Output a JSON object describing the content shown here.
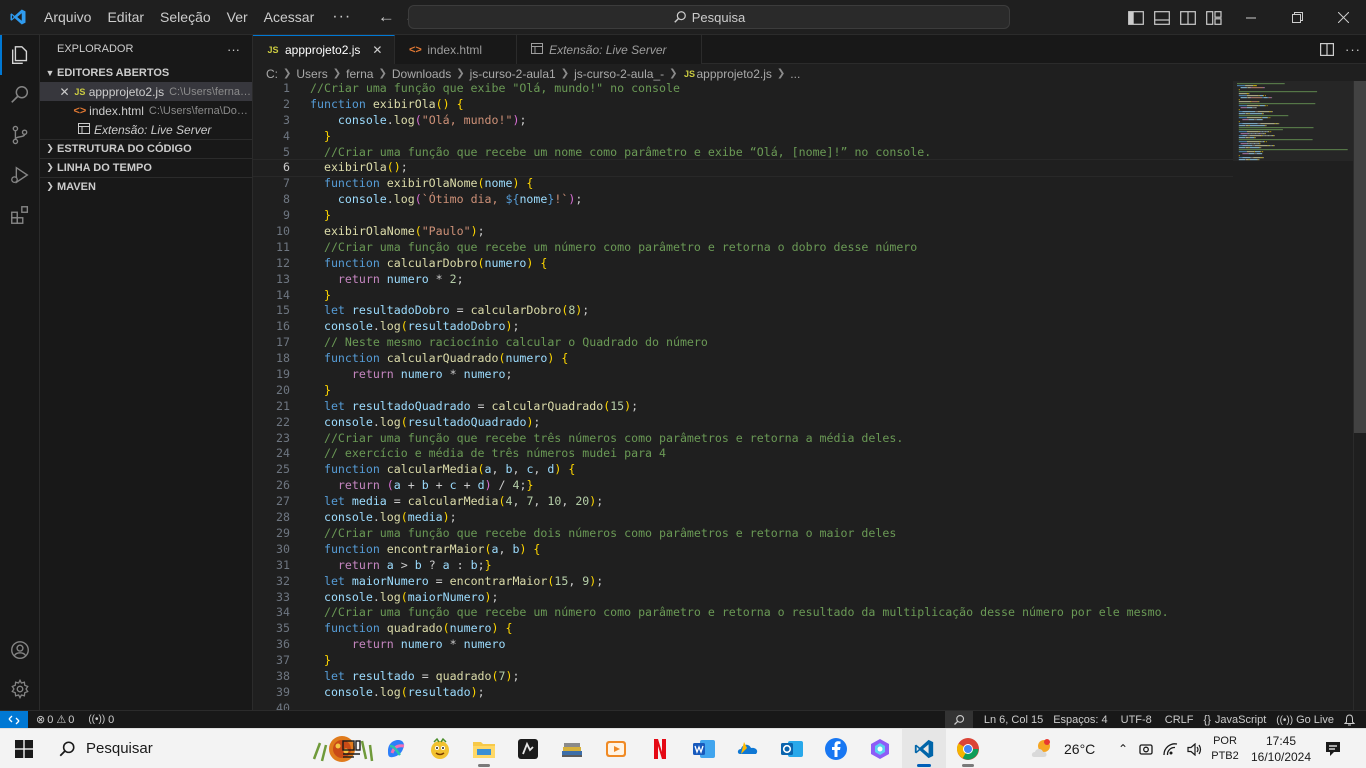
{
  "titlebar": {
    "menu": [
      "Arquivo",
      "Editar",
      "Seleção",
      "Ver",
      "Acessar"
    ],
    "more": "···",
    "search_label": "Pesquisa"
  },
  "sidebar": {
    "title": "EXPLORADOR",
    "more": "···",
    "sections": {
      "open_editors": "EDITORES ABERTOS",
      "outline": "ESTRUTURA DO CÓDIGO",
      "timeline": "LINHA DO TEMPO",
      "maven": "MAVEN"
    },
    "open_files": [
      {
        "name": "appprojeto2.js",
        "path": "C:\\Users\\ferna\\Do...",
        "type": "js"
      },
      {
        "name": "index.html",
        "path": "C:\\Users\\ferna\\Downl...",
        "type": "html"
      },
      {
        "name": "Extensão: Live Server",
        "path": "",
        "type": "ext"
      }
    ]
  },
  "tabs": [
    {
      "label": "appprojeto2.js",
      "type": "js",
      "active": true
    },
    {
      "label": "index.html",
      "type": "html",
      "active": false
    },
    {
      "label": "Extensão: Live Server",
      "type": "ext",
      "active": false
    }
  ],
  "breadcrumb": [
    "C:",
    "Users",
    "ferna",
    "Downloads",
    "js-curso-2-aula1",
    "js-curso-2-aula_-",
    "appprojeto2.js",
    "..."
  ],
  "editor": {
    "current_line": 6,
    "lines": [
      [
        [
          "c-com",
          "//Criar uma função que exibe \"Olá, mundo!\" no console"
        ]
      ],
      [
        [
          "c-kw",
          "function "
        ],
        [
          "c-fn",
          "exibirOla"
        ],
        [
          "c-brk1",
          "() {"
        ]
      ],
      [
        [
          "c-txt",
          "    "
        ],
        [
          "c-var",
          "console"
        ],
        [
          "c-txt",
          "."
        ],
        [
          "c-fn",
          "log"
        ],
        [
          "c-brk2",
          "("
        ],
        [
          "c-str",
          "\"Olá, mundo!\""
        ],
        [
          "c-brk2",
          ")"
        ],
        [
          "c-txt",
          ";"
        ]
      ],
      [
        [
          "c-txt",
          "  "
        ],
        [
          "c-brk1",
          "}"
        ]
      ],
      [
        [
          "c-txt",
          "  "
        ],
        [
          "c-com",
          "//Criar uma função que recebe um nome como parâmetro e exibe “Olá, [nome]!” no console."
        ]
      ],
      [
        [
          "c-txt",
          "  "
        ],
        [
          "c-fn",
          "exibirOla"
        ],
        [
          "c-brk1",
          "()"
        ],
        [
          "c-txt",
          ";"
        ]
      ],
      [
        [
          "c-txt",
          "  "
        ],
        [
          "c-kw",
          "function "
        ],
        [
          "c-fn",
          "exibirOlaNome"
        ],
        [
          "c-brk1",
          "("
        ],
        [
          "c-var",
          "nome"
        ],
        [
          "c-brk1",
          ")"
        ],
        [
          "c-txt",
          " "
        ],
        [
          "c-brk1",
          "{"
        ]
      ],
      [
        [
          "c-txt",
          "    "
        ],
        [
          "c-var",
          "console"
        ],
        [
          "c-txt",
          "."
        ],
        [
          "c-fn",
          "log"
        ],
        [
          "c-brk2",
          "("
        ],
        [
          "c-str",
          "`Ótimo dia, "
        ],
        [
          "c-kw",
          "${"
        ],
        [
          "c-var",
          "nome"
        ],
        [
          "c-kw",
          "}"
        ],
        [
          "c-str",
          "!`"
        ],
        [
          "c-brk2",
          ")"
        ],
        [
          "c-txt",
          ";"
        ]
      ],
      [
        [
          "c-txt",
          "  "
        ],
        [
          "c-brk1",
          "}"
        ]
      ],
      [
        [
          "c-txt",
          "  "
        ],
        [
          "c-fn",
          "exibirOlaNome"
        ],
        [
          "c-brk1",
          "("
        ],
        [
          "c-str",
          "\"Paulo\""
        ],
        [
          "c-brk1",
          ")"
        ],
        [
          "c-txt",
          ";"
        ]
      ],
      [
        [
          "c-txt",
          "  "
        ],
        [
          "c-com",
          "//Criar uma função que recebe um número como parâmetro e retorna o dobro desse número"
        ]
      ],
      [
        [
          "c-txt",
          "  "
        ],
        [
          "c-kw",
          "function "
        ],
        [
          "c-fn",
          "calcularDobro"
        ],
        [
          "c-brk1",
          "("
        ],
        [
          "c-var",
          "numero"
        ],
        [
          "c-brk1",
          ")"
        ],
        [
          "c-txt",
          " "
        ],
        [
          "c-brk1",
          "{"
        ]
      ],
      [
        [
          "c-txt",
          "    "
        ],
        [
          "c-ctl",
          "return "
        ],
        [
          "c-var",
          "numero"
        ],
        [
          "c-txt",
          " * "
        ],
        [
          "c-num",
          "2"
        ],
        [
          "c-txt",
          ";"
        ]
      ],
      [
        [
          "c-txt",
          "  "
        ],
        [
          "c-brk1",
          "}"
        ]
      ],
      [
        [
          "c-txt",
          "  "
        ],
        [
          "c-kw",
          "let "
        ],
        [
          "c-var",
          "resultadoDobro"
        ],
        [
          "c-txt",
          " = "
        ],
        [
          "c-fn",
          "calcularDobro"
        ],
        [
          "c-brk1",
          "("
        ],
        [
          "c-num",
          "8"
        ],
        [
          "c-brk1",
          ")"
        ],
        [
          "c-txt",
          ";"
        ]
      ],
      [
        [
          "c-txt",
          "  "
        ],
        [
          "c-var",
          "console"
        ],
        [
          "c-txt",
          "."
        ],
        [
          "c-fn",
          "log"
        ],
        [
          "c-brk1",
          "("
        ],
        [
          "c-var",
          "resultadoDobro"
        ],
        [
          "c-brk1",
          ")"
        ],
        [
          "c-txt",
          ";"
        ]
      ],
      [
        [
          "c-txt",
          "  "
        ],
        [
          "c-com",
          "// Neste mesmo raciocínio calcular o Quadrado do número"
        ]
      ],
      [
        [
          "c-txt",
          "  "
        ],
        [
          "c-kw",
          "function "
        ],
        [
          "c-fn",
          "calcularQuadrado"
        ],
        [
          "c-brk1",
          "("
        ],
        [
          "c-var",
          "numero"
        ],
        [
          "c-brk1",
          ")"
        ],
        [
          "c-txt",
          " "
        ],
        [
          "c-brk1",
          "{"
        ]
      ],
      [
        [
          "c-txt",
          "      "
        ],
        [
          "c-ctl",
          "return "
        ],
        [
          "c-var",
          "numero"
        ],
        [
          "c-txt",
          " * "
        ],
        [
          "c-var",
          "numero"
        ],
        [
          "c-txt",
          ";"
        ]
      ],
      [
        [
          "c-txt",
          "  "
        ],
        [
          "c-brk1",
          "}"
        ]
      ],
      [
        [
          "c-txt",
          "  "
        ],
        [
          "c-kw",
          "let "
        ],
        [
          "c-var",
          "resultadoQuadrado"
        ],
        [
          "c-txt",
          " = "
        ],
        [
          "c-fn",
          "calcularQuadrado"
        ],
        [
          "c-brk1",
          "("
        ],
        [
          "c-num",
          "15"
        ],
        [
          "c-brk1",
          ")"
        ],
        [
          "c-txt",
          ";"
        ]
      ],
      [
        [
          "c-txt",
          "  "
        ],
        [
          "c-var",
          "console"
        ],
        [
          "c-txt",
          "."
        ],
        [
          "c-fn",
          "log"
        ],
        [
          "c-brk1",
          "("
        ],
        [
          "c-var",
          "resultadoQuadrado"
        ],
        [
          "c-brk1",
          ")"
        ],
        [
          "c-txt",
          ";"
        ]
      ],
      [
        [
          "c-txt",
          "  "
        ],
        [
          "c-com",
          "//Criar uma função que recebe três números como parâmetros e retorna a média deles."
        ]
      ],
      [
        [
          "c-txt",
          "  "
        ],
        [
          "c-com",
          "// exercício e média de três números mudei para 4"
        ]
      ],
      [
        [
          "c-txt",
          "  "
        ],
        [
          "c-kw",
          "function "
        ],
        [
          "c-fn",
          "calcularMedia"
        ],
        [
          "c-brk1",
          "("
        ],
        [
          "c-var",
          "a"
        ],
        [
          "c-txt",
          ", "
        ],
        [
          "c-var",
          "b"
        ],
        [
          "c-txt",
          ", "
        ],
        [
          "c-var",
          "c"
        ],
        [
          "c-txt",
          ", "
        ],
        [
          "c-var",
          "d"
        ],
        [
          "c-brk1",
          ")"
        ],
        [
          "c-txt",
          " "
        ],
        [
          "c-brk1",
          "{"
        ]
      ],
      [
        [
          "c-txt",
          "    "
        ],
        [
          "c-ctl",
          "return "
        ],
        [
          "c-brk2",
          "("
        ],
        [
          "c-var",
          "a"
        ],
        [
          "c-txt",
          " + "
        ],
        [
          "c-var",
          "b"
        ],
        [
          "c-txt",
          " + "
        ],
        [
          "c-var",
          "c"
        ],
        [
          "c-txt",
          " + "
        ],
        [
          "c-var",
          "d"
        ],
        [
          "c-brk2",
          ")"
        ],
        [
          "c-txt",
          " / "
        ],
        [
          "c-num",
          "4"
        ],
        [
          "c-txt",
          ";"
        ],
        [
          "c-brk1",
          "}"
        ]
      ],
      [
        [
          "c-txt",
          "  "
        ],
        [
          "c-kw",
          "let "
        ],
        [
          "c-var",
          "media"
        ],
        [
          "c-txt",
          " = "
        ],
        [
          "c-fn",
          "calcularMedia"
        ],
        [
          "c-brk1",
          "("
        ],
        [
          "c-num",
          "4"
        ],
        [
          "c-txt",
          ", "
        ],
        [
          "c-num",
          "7"
        ],
        [
          "c-txt",
          ", "
        ],
        [
          "c-num",
          "10"
        ],
        [
          "c-txt",
          ", "
        ],
        [
          "c-num",
          "20"
        ],
        [
          "c-brk1",
          ")"
        ],
        [
          "c-txt",
          ";"
        ]
      ],
      [
        [
          "c-txt",
          "  "
        ],
        [
          "c-var",
          "console"
        ],
        [
          "c-txt",
          "."
        ],
        [
          "c-fn",
          "log"
        ],
        [
          "c-brk1",
          "("
        ],
        [
          "c-var",
          "media"
        ],
        [
          "c-brk1",
          ")"
        ],
        [
          "c-txt",
          ";"
        ]
      ],
      [
        [
          "c-txt",
          "  "
        ],
        [
          "c-com",
          "//Criar uma função que recebe dois números como parâmetros e retorna o maior deles"
        ]
      ],
      [
        [
          "c-txt",
          "  "
        ],
        [
          "c-kw",
          "function "
        ],
        [
          "c-fn",
          "encontrarMaior"
        ],
        [
          "c-brk1",
          "("
        ],
        [
          "c-var",
          "a"
        ],
        [
          "c-txt",
          ", "
        ],
        [
          "c-var",
          "b"
        ],
        [
          "c-brk1",
          ")"
        ],
        [
          "c-txt",
          " "
        ],
        [
          "c-brk1",
          "{"
        ]
      ],
      [
        [
          "c-txt",
          "    "
        ],
        [
          "c-ctl",
          "return "
        ],
        [
          "c-var",
          "a"
        ],
        [
          "c-txt",
          " > "
        ],
        [
          "c-var",
          "b"
        ],
        [
          "c-txt",
          " ? "
        ],
        [
          "c-var",
          "a"
        ],
        [
          "c-txt",
          " : "
        ],
        [
          "c-var",
          "b"
        ],
        [
          "c-txt",
          ";"
        ],
        [
          "c-brk1",
          "}"
        ]
      ],
      [
        [
          "c-txt",
          "  "
        ],
        [
          "c-kw",
          "let "
        ],
        [
          "c-var",
          "maiorNumero"
        ],
        [
          "c-txt",
          " = "
        ],
        [
          "c-fn",
          "encontrarMaior"
        ],
        [
          "c-brk1",
          "("
        ],
        [
          "c-num",
          "15"
        ],
        [
          "c-txt",
          ", "
        ],
        [
          "c-num",
          "9"
        ],
        [
          "c-brk1",
          ")"
        ],
        [
          "c-txt",
          ";"
        ]
      ],
      [
        [
          "c-txt",
          "  "
        ],
        [
          "c-var",
          "console"
        ],
        [
          "c-txt",
          "."
        ],
        [
          "c-fn",
          "log"
        ],
        [
          "c-brk1",
          "("
        ],
        [
          "c-var",
          "maiorNumero"
        ],
        [
          "c-brk1",
          ")"
        ],
        [
          "c-txt",
          ";"
        ]
      ],
      [
        [
          "c-txt",
          "  "
        ],
        [
          "c-com",
          "//Criar uma função que recebe um número como parâmetro e retorna o resultado da multiplicação desse número por ele mesmo."
        ]
      ],
      [
        [
          "c-txt",
          "  "
        ],
        [
          "c-kw",
          "function "
        ],
        [
          "c-fn",
          "quadrado"
        ],
        [
          "c-brk1",
          "("
        ],
        [
          "c-var",
          "numero"
        ],
        [
          "c-brk1",
          ")"
        ],
        [
          "c-txt",
          " "
        ],
        [
          "c-brk1",
          "{"
        ]
      ],
      [
        [
          "c-txt",
          "      "
        ],
        [
          "c-ctl",
          "return "
        ],
        [
          "c-var",
          "numero"
        ],
        [
          "c-txt",
          " * "
        ],
        [
          "c-var",
          "numero"
        ]
      ],
      [
        [
          "c-txt",
          "  "
        ],
        [
          "c-brk1",
          "}"
        ]
      ],
      [
        [
          "c-txt",
          "  "
        ],
        [
          "c-kw",
          "let "
        ],
        [
          "c-var",
          "resultado"
        ],
        [
          "c-txt",
          " = "
        ],
        [
          "c-fn",
          "quadrado"
        ],
        [
          "c-brk1",
          "("
        ],
        [
          "c-num",
          "7"
        ],
        [
          "c-brk1",
          ")"
        ],
        [
          "c-txt",
          ";"
        ]
      ],
      [
        [
          "c-txt",
          "  "
        ],
        [
          "c-var",
          "console"
        ],
        [
          "c-txt",
          "."
        ],
        [
          "c-fn",
          "log"
        ],
        [
          "c-brk1",
          "("
        ],
        [
          "c-var",
          "resultado"
        ],
        [
          "c-brk1",
          ")"
        ],
        [
          "c-txt",
          ";"
        ]
      ],
      []
    ]
  },
  "statusbar": {
    "errors": "0",
    "warnings": "0",
    "ports": "0",
    "position": "Ln 6, Col 15",
    "spaces": "Espaços: 4",
    "encoding": "UTF-8",
    "eol": "CRLF",
    "language": "JavaScript",
    "golive": "Go Live"
  },
  "taskbar": {
    "search": "Pesquisar",
    "weather": "26°C",
    "lang1": "POR",
    "lang2": "PTB2",
    "time": "17:45",
    "date": "16/10/2024"
  },
  "colors": {
    "accent": "#0078d4",
    "editor_bg": "#1f1f1f",
    "sidebar_bg": "#181818"
  }
}
